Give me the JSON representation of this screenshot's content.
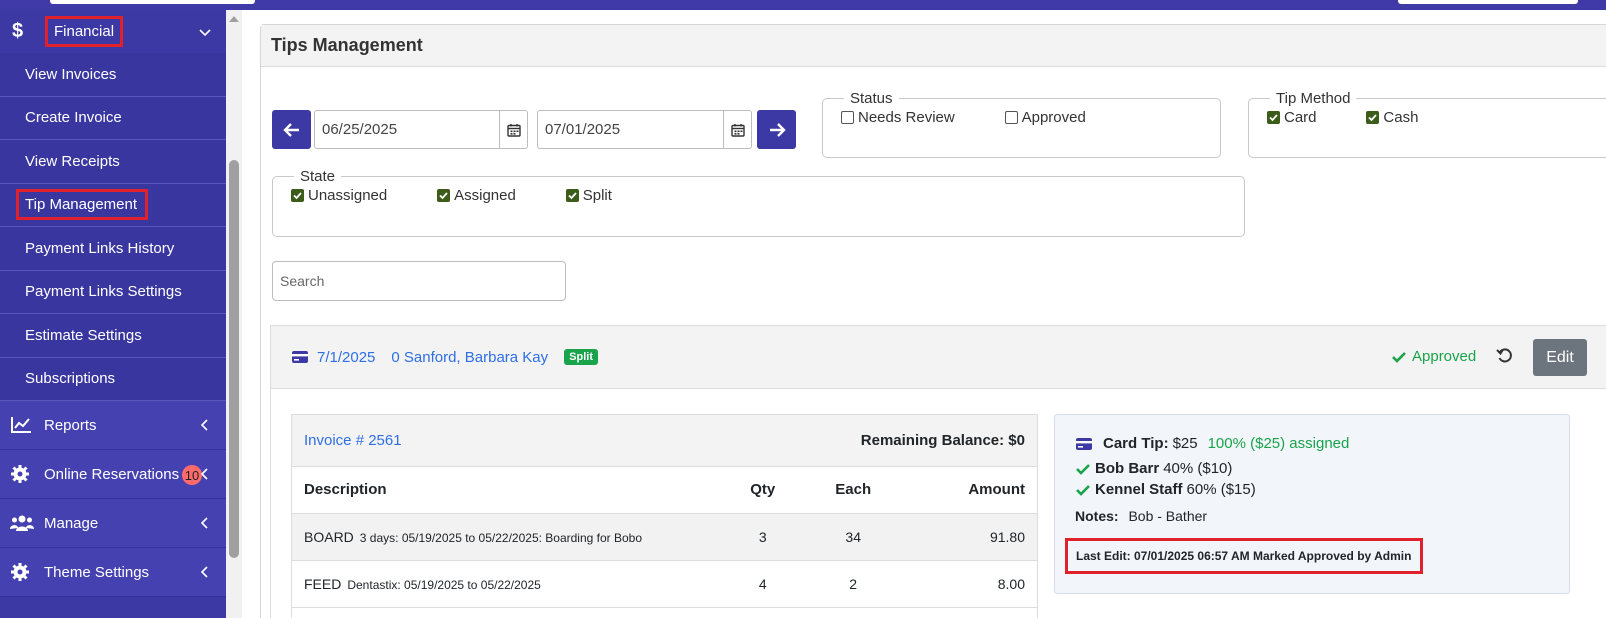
{
  "sidebar": {
    "section_financial": "Financial",
    "financial_items": [
      {
        "label": "View Invoices"
      },
      {
        "label": "Create Invoice"
      },
      {
        "label": "View Receipts"
      },
      {
        "label": "Tip Management"
      },
      {
        "label": "Payment Links History"
      },
      {
        "label": "Payment Links Settings"
      },
      {
        "label": "Estimate Settings"
      },
      {
        "label": "Subscriptions"
      }
    ],
    "sections": [
      {
        "label": "Reports",
        "icon": "chart-line-icon"
      },
      {
        "label": "Online Reservations",
        "icon": "gear-icon",
        "badge": "10"
      },
      {
        "label": "Manage",
        "icon": "users-icon"
      },
      {
        "label": "Theme Settings",
        "icon": "gear-icon"
      }
    ]
  },
  "page": {
    "title": "Tips Management"
  },
  "filters": {
    "start_date": "06/25/2025",
    "end_date": "07/01/2025",
    "status": {
      "legend": "Status",
      "options": [
        {
          "label": "Needs Review",
          "checked": false
        },
        {
          "label": "Approved",
          "checked": false
        }
      ]
    },
    "tip_method": {
      "legend": "Tip Method",
      "options": [
        {
          "label": "Card",
          "checked": true
        },
        {
          "label": "Cash",
          "checked": true
        }
      ]
    },
    "state": {
      "legend": "State",
      "options": [
        {
          "label": "Unassigned",
          "checked": true
        },
        {
          "label": "Assigned",
          "checked": true
        },
        {
          "label": "Split",
          "checked": true
        }
      ]
    },
    "search_placeholder": "Search"
  },
  "tip": {
    "date": "7/1/2025",
    "customer": "0 Sanford, Barbara Kay",
    "badge": "Split",
    "status": "Approved",
    "edit_label": "Edit",
    "invoice": {
      "number": "Invoice # 2561",
      "balance": "Remaining Balance: $0",
      "columns": [
        "Description",
        "Qty",
        "Each",
        "Amount"
      ],
      "rows": [
        {
          "item": "BOARD",
          "detail": "3 days: 05/19/2025 to 05/22/2025: Boarding for Bobo",
          "qty": "3",
          "each": "34",
          "amount": "91.80"
        },
        {
          "item": "FEED",
          "detail": "Dentastix: 05/19/2025 to 05/22/2025",
          "qty": "4",
          "each": "2",
          "amount": "8.00"
        }
      ]
    },
    "details": {
      "type_label": "Card Tip:",
      "amount": "$25",
      "assigned": "100% ($25) assigned",
      "staff": [
        {
          "name": "Bob Barr",
          "share": "40% ($10)"
        },
        {
          "name": "Kennel Staff",
          "share": "60% ($15)"
        }
      ],
      "notes_label": "Notes:",
      "notes": "Bob - Bather",
      "last_edit": "Last Edit: 07/01/2025 06:57 AM Marked Approved by Admin"
    }
  },
  "colors": {
    "primary": "#3d39a4",
    "success": "#19a34a",
    "link": "#2f6fe4",
    "highlight": "#e0202b"
  }
}
